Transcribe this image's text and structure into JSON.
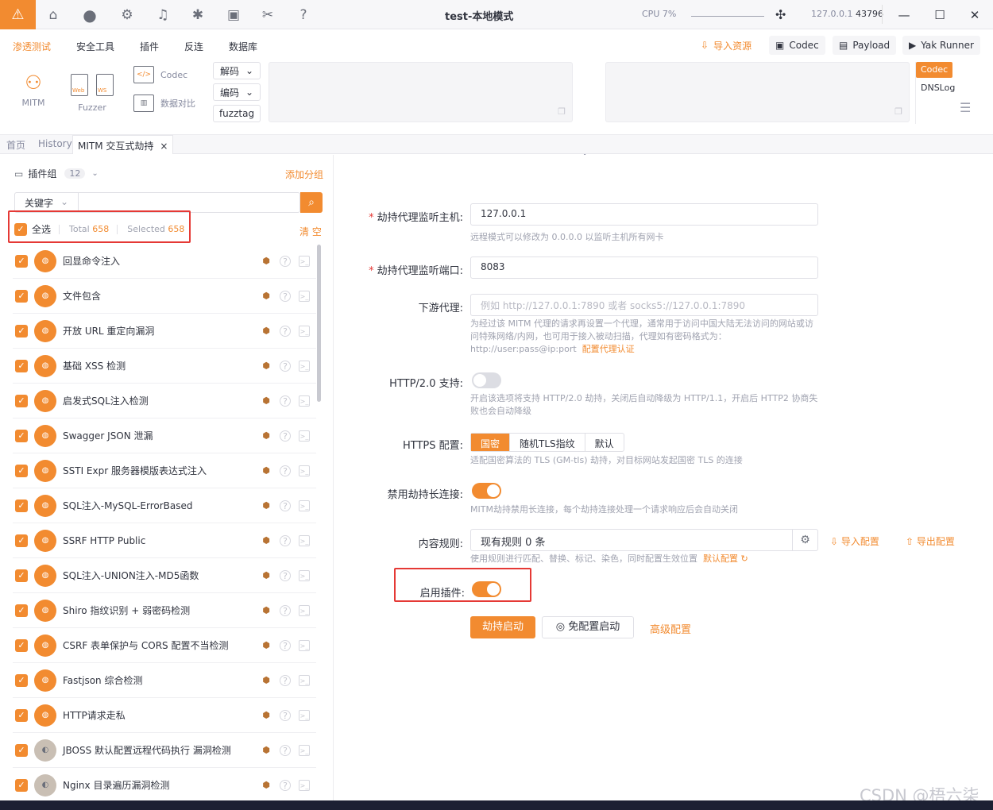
{
  "titlebar": {
    "title": "test-本地模式",
    "cpu": "CPU 7%",
    "addr_host": "127.0.0.1",
    "addr_port": "43796"
  },
  "menu": {
    "items": [
      "渗透测试",
      "安全工具",
      "插件",
      "反连",
      "数据库"
    ],
    "import_resources": "导入资源",
    "codec": "Codec",
    "payload": "Payload",
    "yak_runner": "Yak Runner"
  },
  "toolbar": {
    "mitm": "MITM",
    "fuzzer": "Fuzzer",
    "web": "Web",
    "ws": "WS",
    "codec": "Codec",
    "data_compare": "数据对比",
    "decode": "解码",
    "encode": "编码",
    "fuzztag": "fuzztag",
    "side_codec": "Codec",
    "side_dnslog": "DNSLog"
  },
  "tabs": {
    "home": "首页",
    "history": "History",
    "mitm": "MITM 交互式劫持"
  },
  "left": {
    "group_label": "插件组",
    "group_count": "12",
    "add_group": "添加分组",
    "keyword": "关键字",
    "select_all": "全选",
    "total_label": "Total",
    "total": "658",
    "selected_label": "Selected",
    "selected": "658",
    "clear": "清 空",
    "plugins": [
      "回显命令注入",
      "文件包含",
      "开放 URL 重定向漏洞",
      "基础 XSS 检测",
      "启发式SQL注入检测",
      "Swagger JSON 泄漏",
      "SSTI Expr 服务器模版表达式注入",
      "SQL注入-MySQL-ErrorBased",
      "SSRF HTTP Public",
      "SQL注入-UNION注入-MD5函数",
      "Shiro 指纹识别 + 弱密码检测",
      "CSRF 表单保护与 CORS 配置不当检测",
      "Fastjson 综合检测",
      "HTTP请求走私",
      "JBOSS 默认配置远程代码执行 漏洞检测",
      "Nginx 目录遍历漏洞检测"
    ]
  },
  "form": {
    "host_label": "劫持代理监听主机:",
    "host_value": "127.0.0.1",
    "host_help": "远程模式可以修改为 0.0.0.0 以监听主机所有网卡",
    "port_label": "劫持代理监听端口:",
    "port_value": "8083",
    "downstream_label": "下游代理:",
    "downstream_placeholder": "例如 http://127.0.0.1:7890 或者 socks5://127.0.0.1:7890",
    "downstream_help": "为经过该 MITM 代理的请求再设置一个代理，通常用于访问中国大陆无法访问的网站或访问特殊网络/内网，也可用于接入被动扫描，代理如有密码格式为：http://user:pass@ip:port",
    "downstream_link": "配置代理认证",
    "http2_label": "HTTP/2.0 支持:",
    "http2_help": "开启该选项将支持 HTTP/2.0 劫持，关闭后自动降级为 HTTP/1.1，开启后 HTTP2 协商失败也会自动降级",
    "https_label": "HTTPS 配置:",
    "https_options": [
      "国密",
      "随机TLS指纹",
      "默认"
    ],
    "https_help": "适配国密算法的 TLS (GM-tls) 劫持，对目标网站发起国密 TLS 的连接",
    "keepalive_label": "禁用劫持长连接:",
    "keepalive_help": "MITM劫持禁用长连接，每个劫持连接处理一个请求响应后会自动关闭",
    "rules_label": "内容规则:",
    "rules_value": "现有规则 0 条",
    "import_config": "导入配置",
    "export_config": "导出配置",
    "rules_help": "使用规则进行匹配、替换、标记、染色，同时配置生效位置",
    "default_config": "默认配置",
    "plugins_label": "启用插件:",
    "start_btn": "劫持启动",
    "noconfig_btn": "免配置启动",
    "advanced_btn": "高级配置"
  },
  "watermark": "CSDN @梧六柒",
  "colors": {
    "accent": "#f28b30",
    "highlight": "#e53935"
  }
}
